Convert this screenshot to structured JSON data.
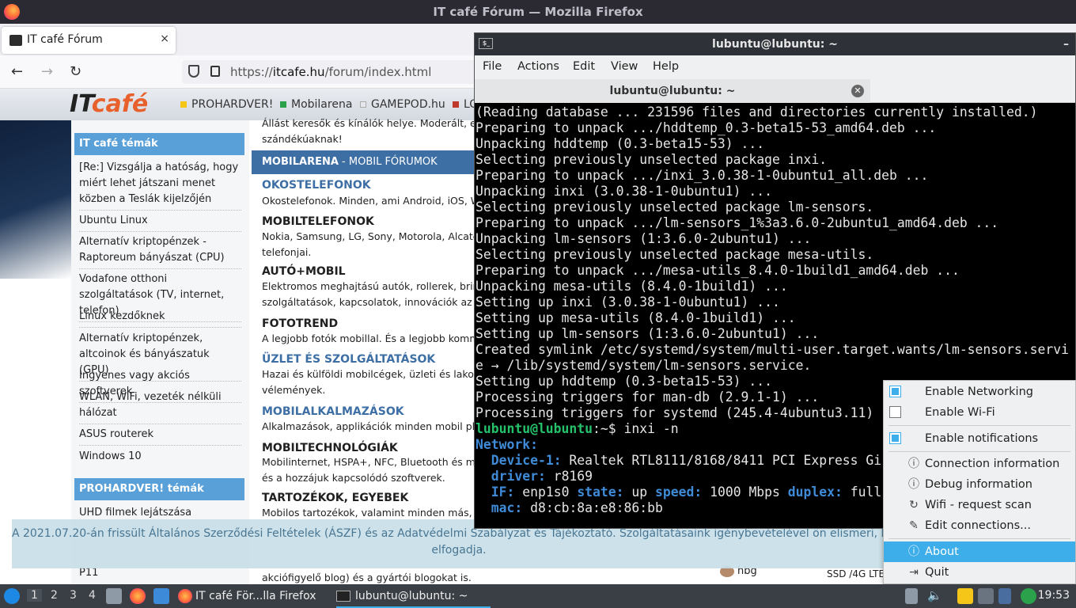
{
  "firefox": {
    "window_title": "IT café Fórum — Mozilla Firefox",
    "tab_title": "IT café Fórum",
    "tab_close": "×",
    "new_tab": "+",
    "url_prefix": "https://",
    "url_domain": "itcafe.hu",
    "url_path": "/forum/index.html"
  },
  "site": {
    "logo_it": "IT",
    "logo_cafe": "café",
    "top_links": [
      "PROHARDVER!",
      "Mobilarena",
      "GAMEPOD.hu",
      "LO"
    ],
    "top_colors": [
      "#f5c518",
      "#2aa14a",
      "#bfc5cc",
      "#c0392b"
    ],
    "sidebar_heading1": "IT café témák",
    "sidebar_items": [
      "[Re:] Vizsgálja a hatóság, hogy miért lehet játszani menet közben a Teslák kijelzőjén",
      "Ubuntu Linux",
      "Alternatív kriptopénzek - Raptoreum bányászat (CPU)",
      "Vodafone otthoni szolgáltatások (TV, internet, telefon)",
      "Linux kezdőknek",
      "Alternatív kriptopénzek, altcoinok és bányászatuk (GPU)",
      "Ingyenes vagy akciós szoftverek",
      "WLAN, WiFi, vezeték nélküli hálózat",
      "ASUS routerek",
      "Windows 10"
    ],
    "sidebar_heading2": "PROHARDVER! témák",
    "sidebar_item_extra": "UHD filmek lejátszása",
    "sidebar_item_p11": "P11",
    "main_intro": "Állást keresők és kínálók helye. Moderált, ezen",
    "main_intro2": "szándékúaknak!",
    "section_header_bold": "MOBILARENA",
    "section_header_rest": " - MOBIL FÓRUMOK",
    "categories": [
      {
        "title": "OKOSTELEFONOK",
        "desc": [
          "Okostelefonok. Minden, ami Android, iOS, Wind"
        ]
      },
      {
        "title": "MOBILTELEFONOK",
        "desc": [
          "Nokia, Samsung, LG, Sony, Motorola, Alcatel és",
          "telefonjai."
        ]
      },
      {
        "title": "AUTÓ+MOBIL",
        "desc": [
          "Elektromos meghajtású autók, rollerek, bringák",
          "szolgáltatások, kapcsolatok, innovációk az aut"
        ]
      },
      {
        "title": "FOTOTREND",
        "desc": [
          "A legjobb fotók mobillal. És a legjobb kommen"
        ]
      },
      {
        "title": "ÜZLET ÉS SZOLGÁLTATÁSOK",
        "desc": [
          "Hazai és külföldi mobilcégek, üzleti és lakossá",
          "vélemények."
        ]
      },
      {
        "title": "MOBILALKALMAZÁSOK",
        "desc": [
          "Alkalmazások, applikációk minden mobil platfo"
        ]
      },
      {
        "title": "MOBILTECHNOLÓGIÁK",
        "desc": [
          "Mobilinternet, HSPA+, NFC, Bluetooth és minde",
          "és a hozzájuk kapcsolódó szoftverek."
        ]
      },
      {
        "title": "TARTOZÉKOK, EGYEBEK",
        "desc": [
          "Mobilos tartozékok, valamint minden más, am"
        ]
      }
    ],
    "bottom_text": "akciófigyelő blog) és a gyártói blogokat is.",
    "bottom_user": "hbg",
    "bottom_right": "SSD /4G LTE",
    "cookie_line1": "A 2021.07.20-án frissült Általános Szerződési Feltételek (ÁSZF) és az Adatvédelmi Szabályzat és Tájékoztató. Szolgáltatásaink igénybevételével ön elismeri, hogy e dokume",
    "cookie_line2": "elfogadja."
  },
  "terminal": {
    "window_title": "lubuntu@lubuntu: ~",
    "menu": [
      "File",
      "Actions",
      "Edit",
      "View",
      "Help"
    ],
    "tab_title": "lubuntu@lubuntu: ~",
    "lines": [
      "(Reading database ... 231596 files and directories currently installed.)",
      "Preparing to unpack .../hddtemp_0.3-beta15-53_amd64.deb ...",
      "Unpacking hddtemp (0.3-beta15-53) ...",
      "Selecting previously unselected package inxi.",
      "Preparing to unpack .../inxi_3.0.38-1-0ubuntu1_all.deb ...",
      "Unpacking inxi (3.0.38-1-0ubuntu1) ...",
      "Selecting previously unselected package lm-sensors.",
      "Preparing to unpack .../lm-sensors_1%3a3.6.0-2ubuntu1_amd64.deb ...",
      "Unpacking lm-sensors (1:3.6.0-2ubuntu1) ...",
      "Selecting previously unselected package mesa-utils.",
      "Preparing to unpack .../mesa-utils_8.4.0-1build1_amd64.deb ...",
      "Unpacking mesa-utils (8.4.0-1build1) ...",
      "Setting up inxi (3.0.38-1-0ubuntu1) ...",
      "Setting up mesa-utils (8.4.0-1build1) ...",
      "Setting up lm-sensors (1:3.6.0-2ubuntu1) ...",
      "Created symlink /etc/systemd/system/multi-user.target.wants/lm-sensors.servi",
      "e → /lib/systemd/system/lm-sensors.service.",
      "Setting up hddtemp (0.3-beta15-53) ...",
      "Processing triggers for man-db (2.9.1-1) ...",
      "Processing triggers for systemd (245.4-4ubuntu3.11) ..."
    ],
    "prompt_user": "lubuntu@lubuntu",
    "prompt_rest": ":~$ inxi -n",
    "net_heading": "Network:",
    "dev_label": "Device-1:",
    "dev_value": " Realtek RTL8111/8168/8411 PCI Express Gi",
    "driver_label": "driver:",
    "driver_value": " r8169",
    "if_label": "IF:",
    "if_value": " enp1s0 ",
    "state_label": "state:",
    "state_value": " up ",
    "speed_label": "speed:",
    "speed_value": " 1000 Mbps ",
    "duplex_label": "duplex:",
    "duplex_value": " full",
    "mac_label": "mac:",
    "mac_value": " d8:cb:8a:e8:86:bb"
  },
  "context_menu": {
    "enable_networking": "Enable Networking",
    "enable_wifi": "Enable Wi-Fi",
    "enable_notifications": "Enable notifications",
    "connection_info": "Connection information",
    "debug_info": "Debug information",
    "wifi_scan": "Wifi - request scan",
    "edit_connections": "Edit connections...",
    "about": "About",
    "quit": "Quit"
  },
  "taskbar": {
    "workspaces": [
      "1",
      "2",
      "3",
      "4"
    ],
    "task_firefox": "IT café För...lla Firefox",
    "task_terminal": "lubuntu@lubuntu: ~",
    "clock": "19:53"
  }
}
